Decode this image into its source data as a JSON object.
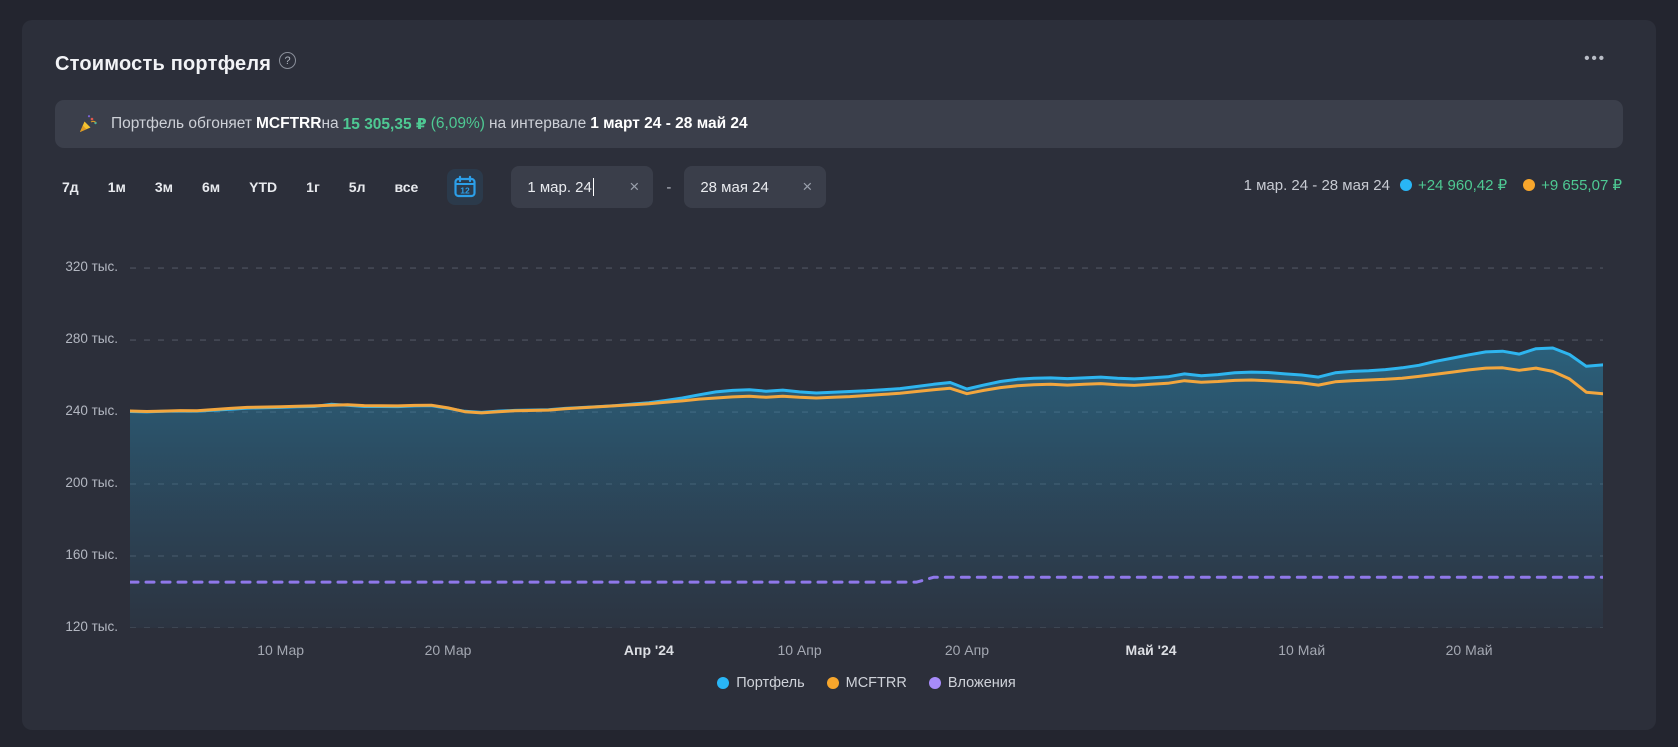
{
  "header": {
    "title": "Стоимость портфеля",
    "help": "?",
    "menu_dots": "•••"
  },
  "banner": {
    "icon": "party-popper",
    "prefix": "Портфель обгоняет",
    "benchmark": "MCFTRR",
    "conn1": "на",
    "amount": "15 305,35 ₽",
    "percent": "(6,09%)",
    "conn2": "на интервале",
    "interval": "1 март 24 - 28 май 24"
  },
  "controls": {
    "ranges": [
      "7д",
      "1м",
      "3м",
      "6м",
      "YTD",
      "1г",
      "5л",
      "все"
    ],
    "calendar_day": "12",
    "date_from": "1 мар. 24",
    "date_to": "28 мая 24",
    "separator": "-",
    "clear_icon": "×"
  },
  "summary": {
    "range_label": "1 мар. 24 - 28 мая 24",
    "portfolio_change": "+24 960,42 ₽",
    "benchmark_change": "+9 655,07 ₽"
  },
  "colors": {
    "portfolio": "#29b6f6",
    "benchmark": "#f2a63e",
    "invested": "#8f78ea",
    "gain_green": "#4ec993",
    "card_bg": "#2c2f3a",
    "banner_bg": "#3b3f4b",
    "grid": "#4a4e5a"
  },
  "chart_data": {
    "type": "line",
    "title": "Стоимость портфеля",
    "unit": "тыс. ₽",
    "grid": "horizontal dashed",
    "legend_position": "bottom-center",
    "ylim": [
      120,
      335
    ],
    "xmax": 88,
    "y_ticks": [
      {
        "v": 320,
        "label": "320 тыс."
      },
      {
        "v": 280,
        "label": "280 тыс."
      },
      {
        "v": 240,
        "label": "240 тыс."
      },
      {
        "v": 200,
        "label": "200 тыс."
      },
      {
        "v": 160,
        "label": "160 тыс."
      },
      {
        "v": 120,
        "label": "120 тыс."
      }
    ],
    "x_ticks": [
      {
        "d": 9,
        "label": "10 Мар"
      },
      {
        "d": 19,
        "label": "20 Мар"
      },
      {
        "d": 31,
        "label": "Апр '24",
        "strong": true
      },
      {
        "d": 40,
        "label": "10 Апр"
      },
      {
        "d": 50,
        "label": "20 Апр"
      },
      {
        "d": 61,
        "label": "Май '24",
        "strong": true
      },
      {
        "d": 70,
        "label": "10 Май"
      },
      {
        "d": 80,
        "label": "20 Май"
      }
    ],
    "legend": [
      {
        "key": "portfolio",
        "label": "Портфель",
        "color": "#29b6f6"
      },
      {
        "key": "mcftrr",
        "label": "MCFTRR",
        "color": "#f7a62c"
      },
      {
        "key": "invested",
        "label": "Вложения",
        "color": "#a78bfa"
      }
    ],
    "series": [
      {
        "key": "portfolio",
        "name": "Портфель",
        "color": "#2eb5ef",
        "area": true,
        "points": [
          [
            0,
            240.3
          ],
          [
            1,
            240.1
          ],
          [
            2,
            240.4
          ],
          [
            3,
            240.6
          ],
          [
            4,
            240.5
          ],
          [
            6,
            241.6
          ],
          [
            7,
            242.2
          ],
          [
            9,
            242.6
          ],
          [
            10,
            242.9
          ],
          [
            11,
            243.1
          ],
          [
            12,
            244.3
          ],
          [
            13,
            243.8
          ],
          [
            14,
            243.1
          ],
          [
            16,
            243.0
          ],
          [
            17,
            243.4
          ],
          [
            18,
            243.6
          ],
          [
            19,
            242.1
          ],
          [
            20,
            240.4
          ],
          [
            21,
            239.8
          ],
          [
            22,
            240.5
          ],
          [
            23,
            240.9
          ],
          [
            25,
            241.3
          ],
          [
            26,
            242.0
          ],
          [
            27,
            242.5
          ],
          [
            28,
            243.0
          ],
          [
            29,
            243.6
          ],
          [
            30,
            244.4
          ],
          [
            31,
            245.2
          ],
          [
            32,
            246.4
          ],
          [
            33,
            247.8
          ],
          [
            34,
            249.6
          ],
          [
            35,
            251.2
          ],
          [
            36,
            252.0
          ],
          [
            37,
            252.4
          ],
          [
            38,
            251.6
          ],
          [
            39,
            252.2
          ],
          [
            40,
            251.2
          ],
          [
            41,
            250.6
          ],
          [
            42,
            251.0
          ],
          [
            43,
            251.4
          ],
          [
            44,
            251.8
          ],
          [
            45,
            252.4
          ],
          [
            46,
            253.0
          ],
          [
            47,
            254.2
          ],
          [
            48,
            255.4
          ],
          [
            49,
            256.4
          ],
          [
            50,
            252.8
          ],
          [
            51,
            255.0
          ],
          [
            52,
            257.0
          ],
          [
            53,
            258.2
          ],
          [
            54,
            258.8
          ],
          [
            55,
            259.0
          ],
          [
            56,
            258.6
          ],
          [
            57,
            259.0
          ],
          [
            58,
            259.4
          ],
          [
            59,
            258.8
          ],
          [
            60,
            258.4
          ],
          [
            61,
            259.0
          ],
          [
            62,
            259.6
          ],
          [
            63,
            261.2
          ],
          [
            64,
            260.2
          ],
          [
            65,
            260.8
          ],
          [
            66,
            261.8
          ],
          [
            67,
            262.2
          ],
          [
            68,
            262.0
          ],
          [
            69,
            261.2
          ],
          [
            70,
            260.6
          ],
          [
            71,
            259.4
          ],
          [
            72,
            261.8
          ],
          [
            73,
            262.6
          ],
          [
            74,
            263.0
          ],
          [
            75,
            263.6
          ],
          [
            76,
            264.6
          ],
          [
            77,
            266.0
          ],
          [
            78,
            268.2
          ],
          [
            79,
            270.0
          ],
          [
            80,
            271.8
          ],
          [
            81,
            273.4
          ],
          [
            82,
            273.8
          ],
          [
            83,
            272.2
          ],
          [
            84,
            275.2
          ],
          [
            85,
            275.6
          ],
          [
            86,
            272.0
          ],
          [
            87,
            265.4
          ],
          [
            88,
            266.2
          ]
        ]
      },
      {
        "key": "mcftrr",
        "name": "MCFTRR",
        "color": "#f2a63e",
        "points": [
          [
            0,
            240.6
          ],
          [
            1,
            240.3
          ],
          [
            2,
            240.5
          ],
          [
            3,
            240.8
          ],
          [
            4,
            240.7
          ],
          [
            6,
            242.0
          ],
          [
            7,
            242.6
          ],
          [
            9,
            242.9
          ],
          [
            10,
            243.2
          ],
          [
            11,
            243.4
          ],
          [
            12,
            243.8
          ],
          [
            13,
            244.0
          ],
          [
            14,
            243.6
          ],
          [
            16,
            243.4
          ],
          [
            17,
            243.7
          ],
          [
            18,
            243.8
          ],
          [
            19,
            242.3
          ],
          [
            20,
            240.2
          ],
          [
            21,
            239.5
          ],
          [
            22,
            240.2
          ],
          [
            23,
            240.7
          ],
          [
            25,
            241.1
          ],
          [
            26,
            241.8
          ],
          [
            27,
            242.4
          ],
          [
            28,
            242.9
          ],
          [
            29,
            243.5
          ],
          [
            30,
            244.0
          ],
          [
            31,
            244.6
          ],
          [
            32,
            245.4
          ],
          [
            33,
            246.2
          ],
          [
            34,
            247.2
          ],
          [
            35,
            247.8
          ],
          [
            36,
            248.4
          ],
          [
            37,
            248.8
          ],
          [
            38,
            248.2
          ],
          [
            39,
            248.8
          ],
          [
            40,
            248.2
          ],
          [
            41,
            247.8
          ],
          [
            42,
            248.2
          ],
          [
            43,
            248.6
          ],
          [
            44,
            249.2
          ],
          [
            45,
            249.8
          ],
          [
            46,
            250.4
          ],
          [
            47,
            251.4
          ],
          [
            48,
            252.4
          ],
          [
            49,
            253.2
          ],
          [
            50,
            250.2
          ],
          [
            51,
            252.0
          ],
          [
            52,
            253.6
          ],
          [
            53,
            254.6
          ],
          [
            54,
            255.2
          ],
          [
            55,
            255.4
          ],
          [
            56,
            255.0
          ],
          [
            57,
            255.4
          ],
          [
            58,
            255.8
          ],
          [
            59,
            255.2
          ],
          [
            60,
            254.8
          ],
          [
            61,
            255.4
          ],
          [
            62,
            256.0
          ],
          [
            63,
            257.4
          ],
          [
            64,
            256.6
          ],
          [
            65,
            257.0
          ],
          [
            66,
            257.6
          ],
          [
            67,
            257.8
          ],
          [
            68,
            257.4
          ],
          [
            69,
            256.8
          ],
          [
            70,
            256.2
          ],
          [
            71,
            255.0
          ],
          [
            72,
            256.8
          ],
          [
            73,
            257.4
          ],
          [
            74,
            257.8
          ],
          [
            75,
            258.2
          ],
          [
            76,
            258.8
          ],
          [
            77,
            259.8
          ],
          [
            78,
            261.0
          ],
          [
            79,
            262.2
          ],
          [
            80,
            263.4
          ],
          [
            81,
            264.4
          ],
          [
            82,
            264.6
          ],
          [
            83,
            263.2
          ],
          [
            84,
            264.4
          ],
          [
            85,
            262.6
          ],
          [
            86,
            258.4
          ],
          [
            87,
            251.0
          ],
          [
            88,
            250.2
          ]
        ]
      },
      {
        "key": "invested",
        "name": "Вложения",
        "color": "#8f78ea",
        "dashed": true,
        "points": [
          [
            0,
            145.5
          ],
          [
            47,
            145.5
          ],
          [
            48,
            148.2
          ],
          [
            88,
            148.2
          ]
        ]
      }
    ]
  }
}
